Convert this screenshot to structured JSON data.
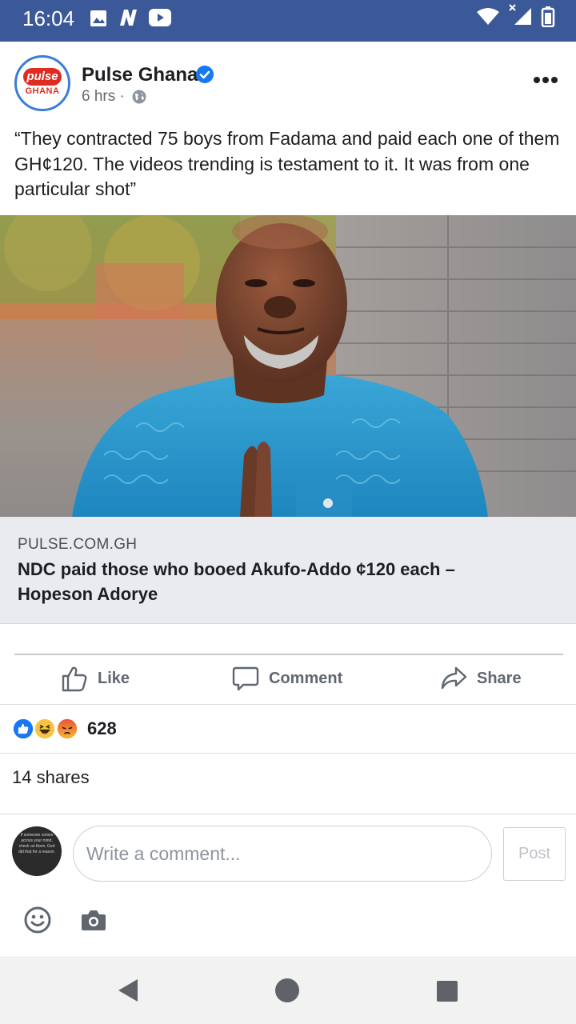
{
  "status_bar": {
    "time": "16:04",
    "background_color": "#3b5998",
    "icons": [
      "image-icon",
      "n-icon",
      "youtube-icon",
      "wifi-icon",
      "signal-icon",
      "battery-icon"
    ]
  },
  "post": {
    "page_name": "Pulse Ghana",
    "avatar_logo_text": "pulse",
    "avatar_sub_text": "GHANA",
    "time": "6 hrs ·",
    "verified": true,
    "text": "“They contracted 75 boys from Fadama and paid each one of them GH¢120. The videos trending is testament to it. It was from one particular shot”"
  },
  "link_preview": {
    "domain": "PULSE.COM.GH",
    "title": "NDC paid those who booed Akufo-Addo ¢120 each – Hopeson Adorye"
  },
  "actions": {
    "like": "Like",
    "comment": "Comment",
    "share": "Share"
  },
  "reactions": {
    "types": [
      "like",
      "haha",
      "angry"
    ],
    "count": "628"
  },
  "shares": "14 shares",
  "composer": {
    "placeholder": "Write a comment...",
    "post_label": "Post",
    "avatar_text": "If someone comes across your mind, check on them. God did that for a reason."
  },
  "colors": {
    "facebook_blue": "#3b5998",
    "verified_blue": "#1877f2",
    "link_bg": "#e9ebee",
    "pulse_red": "#e02b20"
  }
}
